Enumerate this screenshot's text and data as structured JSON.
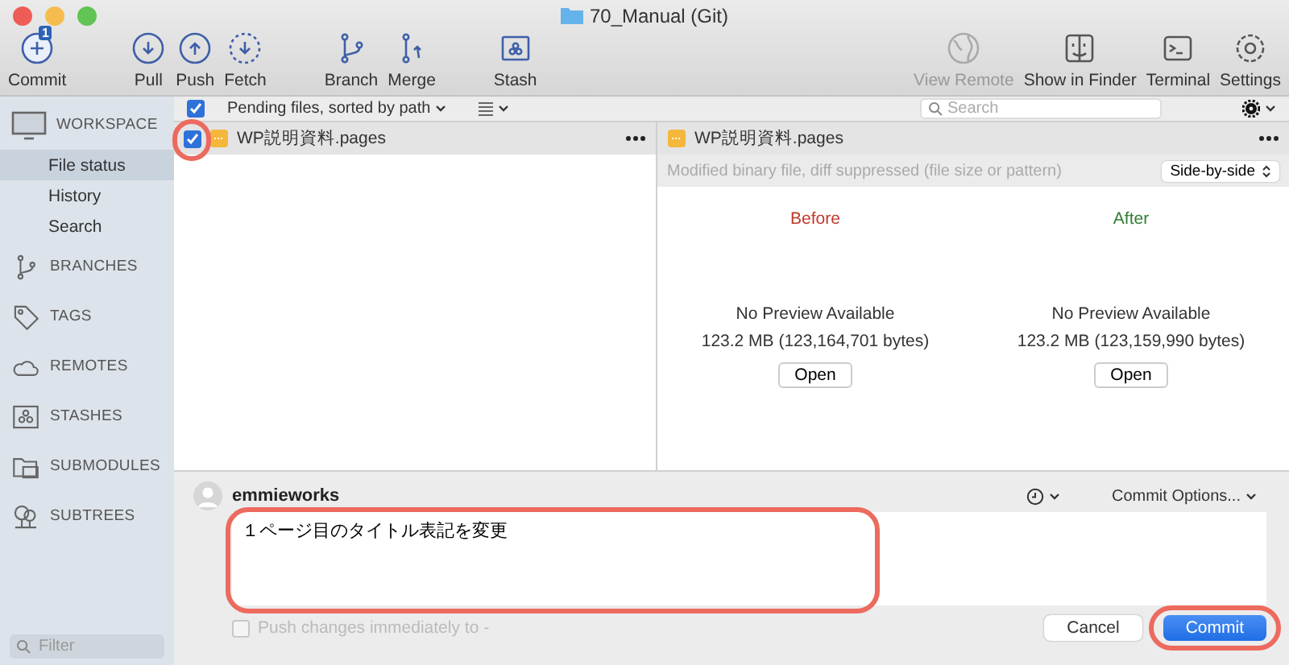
{
  "window": {
    "title": "70_Manual (Git)"
  },
  "toolbar": [
    {
      "kind": "commit",
      "label": "Commit",
      "badge": "1",
      "disabled": false
    },
    {
      "kind": "pull",
      "label": "Pull",
      "disabled": false
    },
    {
      "kind": "push",
      "label": "Push",
      "disabled": false
    },
    {
      "kind": "fetch",
      "label": "Fetch",
      "disabled": false
    },
    {
      "kind": "branch",
      "label": "Branch",
      "disabled": false
    },
    {
      "kind": "merge",
      "label": "Merge",
      "disabled": false
    },
    {
      "kind": "stash",
      "label": "Stash",
      "disabled": false
    },
    {
      "kind": "globe",
      "label": "View Remote",
      "disabled": true
    },
    {
      "kind": "finder",
      "label": "Show in Finder",
      "disabled": false
    },
    {
      "kind": "terminal",
      "label": "Terminal",
      "disabled": false
    },
    {
      "kind": "settings",
      "label": "Settings",
      "disabled": false
    }
  ],
  "sidebar": {
    "sections": [
      {
        "kind": "workspace",
        "label": "WORKSPACE",
        "items": [
          {
            "label": "File status",
            "selected": true
          },
          {
            "label": "History",
            "selected": false
          },
          {
            "label": "Search",
            "selected": false
          }
        ]
      },
      {
        "kind": "branches",
        "label": "BRANCHES"
      },
      {
        "kind": "tags",
        "label": "TAGS"
      },
      {
        "kind": "remotes",
        "label": "REMOTES"
      },
      {
        "kind": "stashes",
        "label": "STASHES"
      },
      {
        "kind": "submodules",
        "label": "SUBMODULES"
      },
      {
        "kind": "subtrees",
        "label": "SUBTREES"
      }
    ],
    "filter": {
      "placeholder": "Filter"
    }
  },
  "file_list": {
    "all_checked": true,
    "sort_label": "Pending files, sorted by path",
    "search": {
      "placeholder": "Search"
    },
    "files": [
      {
        "name": "WP説明資料.pages",
        "checked": true,
        "highlighted": true
      }
    ]
  },
  "diff": {
    "file": "WP説明資料.pages",
    "message": "Modified binary file, diff suppressed (file size or pattern)",
    "mode": "Side-by-side",
    "panes": [
      {
        "kind": "before",
        "heading": "Before",
        "status": "No Preview Available",
        "size": "123.2 MB (123,164,701 bytes)",
        "button": "Open"
      },
      {
        "kind": "after",
        "heading": "After",
        "status": "No Preview Available",
        "size": "123.2 MB (123,159,990 bytes)",
        "button": "Open"
      }
    ]
  },
  "commit": {
    "author": "emmieworks",
    "options": "Commit Options...",
    "message": "１ページ目のタイトル表記を変更",
    "message_highlighted": true,
    "push_immediately": {
      "label": "Push changes immediately to -",
      "checked": false
    },
    "buttons": [
      {
        "kind": "cancel",
        "label": "Cancel",
        "highlighted": false
      },
      {
        "kind": "primary",
        "label": "Commit",
        "highlighted": true
      }
    ]
  }
}
